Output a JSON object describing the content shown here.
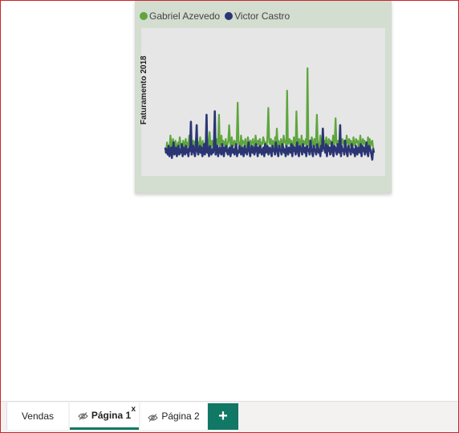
{
  "chart_data": {
    "type": "line",
    "ylabel": "Faturamento 2018",
    "legend_placement": "top-left",
    "series": [
      {
        "name": "Gabriel Azevedo",
        "color": "#5ea53f",
        "values": [
          6,
          7,
          12,
          8,
          10,
          9,
          16,
          11,
          8,
          14,
          10,
          9,
          13,
          7,
          10,
          12,
          9,
          15,
          11,
          8,
          10,
          13,
          9,
          11,
          14,
          8,
          12,
          10,
          16,
          9,
          11,
          7,
          10,
          13,
          12,
          9,
          14,
          10,
          8,
          12,
          11,
          15,
          9,
          10,
          13,
          8,
          11,
          12,
          9,
          14,
          10,
          11,
          18,
          12,
          9,
          13,
          10,
          8,
          15,
          11,
          14,
          9,
          12,
          28,
          10,
          11,
          16,
          9,
          13,
          12,
          10,
          14,
          8,
          11,
          13,
          22,
          12,
          9,
          15,
          11,
          10,
          13,
          12,
          9,
          14,
          35,
          11,
          12,
          9,
          16,
          10,
          13,
          12,
          11,
          14,
          9,
          10,
          15,
          12,
          8,
          13,
          11,
          12,
          14,
          10,
          9,
          16,
          12,
          11,
          13,
          10,
          14,
          9,
          12,
          11,
          15,
          13,
          10,
          12,
          9,
          16,
          32,
          12,
          11,
          14,
          10,
          13,
          12,
          9,
          15,
          11,
          20,
          10,
          13,
          12,
          9,
          14,
          11,
          10,
          16,
          12,
          13,
          9,
          42,
          11,
          12,
          14,
          10,
          13,
          11,
          9,
          15,
          12,
          10,
          30,
          13,
          11,
          14,
          12,
          9,
          16,
          10,
          13,
          12,
          11,
          14,
          9,
          55,
          12,
          10,
          13,
          11,
          15,
          12,
          9,
          14,
          10,
          13,
          28,
          11,
          12,
          9,
          16,
          10,
          14,
          12,
          11,
          13,
          9,
          15,
          12,
          10,
          14,
          11,
          13,
          12,
          9,
          16,
          10,
          14,
          26,
          11,
          12,
          13,
          9,
          15,
          10,
          12,
          14,
          11,
          13,
          10,
          9,
          16,
          12,
          11,
          14,
          10,
          13,
          12,
          9,
          15,
          11,
          10,
          14,
          12,
          13,
          9,
          11,
          16,
          10,
          12,
          14,
          11,
          13,
          10,
          12,
          9,
          15,
          11,
          14,
          10,
          12,
          13,
          9,
          8
        ]
      },
      {
        "name": "Victor Castro",
        "color": "#2b3574",
        "values": [
          9,
          6,
          8,
          5,
          10,
          4,
          7,
          9,
          3,
          8,
          12,
          5,
          6,
          9,
          4,
          7,
          10,
          5,
          8,
          6,
          11,
          4,
          9,
          7,
          5,
          10,
          6,
          8,
          4,
          9,
          7,
          24,
          5,
          8,
          10,
          6,
          4,
          9,
          22,
          7,
          5,
          8,
          10,
          6,
          9,
          4,
          7,
          11,
          5,
          8,
          28,
          6,
          9,
          4,
          10,
          7,
          5,
          8,
          6,
          9,
          30,
          5,
          8,
          10,
          4,
          7,
          9,
          6,
          5,
          11,
          8,
          4,
          9,
          7,
          10,
          6,
          5,
          8,
          9,
          4,
          7,
          10,
          6,
          8,
          5,
          9,
          11,
          4,
          7,
          6,
          10,
          8,
          5,
          9,
          7,
          4,
          10,
          6,
          8,
          5,
          9,
          12,
          7,
          4,
          8,
          10,
          6,
          9,
          5,
          7,
          11,
          8,
          4,
          9,
          6,
          10,
          7,
          5,
          8,
          9,
          4,
          11,
          6,
          7,
          10,
          5,
          8,
          9,
          6,
          4,
          10,
          7,
          8,
          5,
          12,
          9,
          6,
          4,
          10,
          8,
          7,
          5,
          11,
          9,
          6,
          8,
          4,
          10,
          7,
          5,
          9,
          8,
          6,
          11,
          4,
          10,
          7,
          9,
          5,
          8,
          12,
          6,
          4,
          10,
          9,
          7,
          5,
          11,
          8,
          6,
          9,
          4,
          10,
          7,
          8,
          5,
          13,
          9,
          6,
          4,
          10,
          8,
          7,
          5,
          11,
          9,
          6,
          8,
          4,
          10,
          7,
          20,
          9,
          8,
          6,
          11,
          4,
          10,
          7,
          9,
          5,
          8,
          12,
          6,
          4,
          10,
          9,
          7,
          5,
          11,
          8,
          6,
          22,
          4,
          10,
          7,
          8,
          5,
          13,
          9,
          6,
          4,
          10,
          8,
          7,
          5,
          11,
          9,
          6,
          8,
          4,
          10,
          7,
          5,
          9,
          8,
          6,
          11,
          4,
          10,
          7,
          9,
          5,
          8,
          12,
          6,
          4,
          10,
          9,
          7,
          5,
          2,
          8,
          6
        ]
      }
    ]
  },
  "tabs": [
    {
      "label": "Vendas",
      "hidden": false,
      "active": false
    },
    {
      "label": "Página 1",
      "hidden": true,
      "active": true,
      "close_label": "x"
    },
    {
      "label": "Página 2",
      "hidden": true,
      "active": false
    }
  ],
  "add_page_label": "+",
  "colors": {
    "accent": "#117865",
    "card_background": "#d3ddd0",
    "plot_background": "#e6e6e6",
    "frame_border": "#c8262c"
  }
}
